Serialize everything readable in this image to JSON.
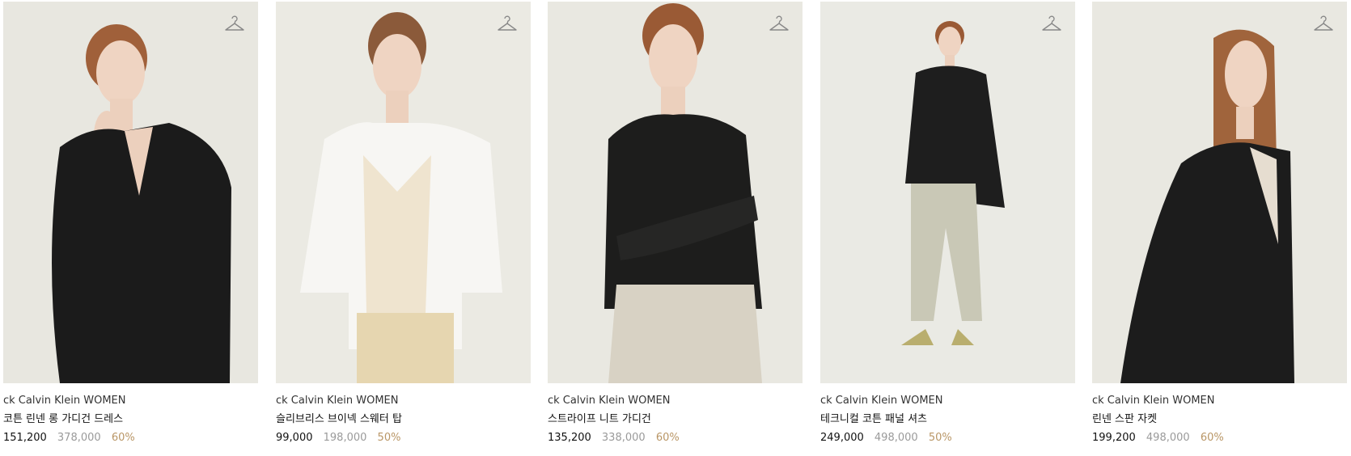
{
  "products": [
    {
      "brand": "ck Calvin Klein WOMEN",
      "name": "코튼 린넨 롱 가디건 드레스",
      "price": "151,200",
      "original_price": "378,000",
      "discount": "60%",
      "outfit_color": "#1b1b1b",
      "inner_color": "#1b1b1b",
      "bottom_color": "#1b1b1b",
      "hair_color": "#a0603a"
    },
    {
      "brand": "ck Calvin Klein WOMEN",
      "name": "슬리브리스 브이넥 스웨터 탑",
      "price": "99,000",
      "original_price": "198,000",
      "discount": "50%",
      "outfit_color": "#f7f6f3",
      "inner_color": "#efe4cf",
      "bottom_color": "#e6d6b0",
      "hair_color": "#8b5a3a"
    },
    {
      "brand": "ck Calvin Klein WOMEN",
      "name": "스트라이프 니트 가디건",
      "price": "135,200",
      "original_price": "338,000",
      "discount": "60%",
      "outfit_color": "#1d1d1c",
      "inner_color": "#1d1d1c",
      "bottom_color": "#d8d2c4",
      "hair_color": "#9a5a35"
    },
    {
      "brand": "ck Calvin Klein WOMEN",
      "name": "테크니컬 코튼 패널 셔츠",
      "price": "249,000",
      "original_price": "498,000",
      "discount": "50%",
      "outfit_color": "#1e1e1e",
      "inner_color": "#1e1e1e",
      "bottom_color": "#c9c8b6",
      "hair_color": "#9a5a35"
    },
    {
      "brand": "ck Calvin Klein WOMEN",
      "name": "린넨 스판 자켓",
      "price": "199,200",
      "original_price": "498,000",
      "discount": "60%",
      "outfit_color": "#1c1c1c",
      "inner_color": "#e6ddd0",
      "bottom_color": "#1c1c1c",
      "hair_color": "#a0643c"
    }
  ],
  "icons": {
    "wishlist": "hanger-icon"
  }
}
